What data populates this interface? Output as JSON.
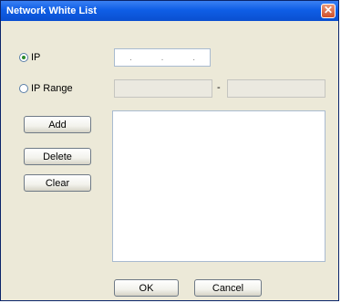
{
  "window": {
    "title": "Network White List",
    "close_glyph": "✕"
  },
  "ip_option": {
    "label": "IP",
    "selected": true
  },
  "ip_input": {
    "separators": [
      ".",
      ".",
      "."
    ]
  },
  "ip_range_option": {
    "label": "IP Range",
    "selected": false
  },
  "ip_range": {
    "separator": "-"
  },
  "buttons": {
    "add": "Add",
    "delete": "Delete",
    "clear": "Clear",
    "ok": "OK",
    "cancel": "Cancel"
  },
  "whitelist": {
    "items": []
  },
  "colors": {
    "title_bar": "#0f5ee6",
    "dialog_bg": "#ece9d8",
    "close_button": "#d2502a"
  }
}
